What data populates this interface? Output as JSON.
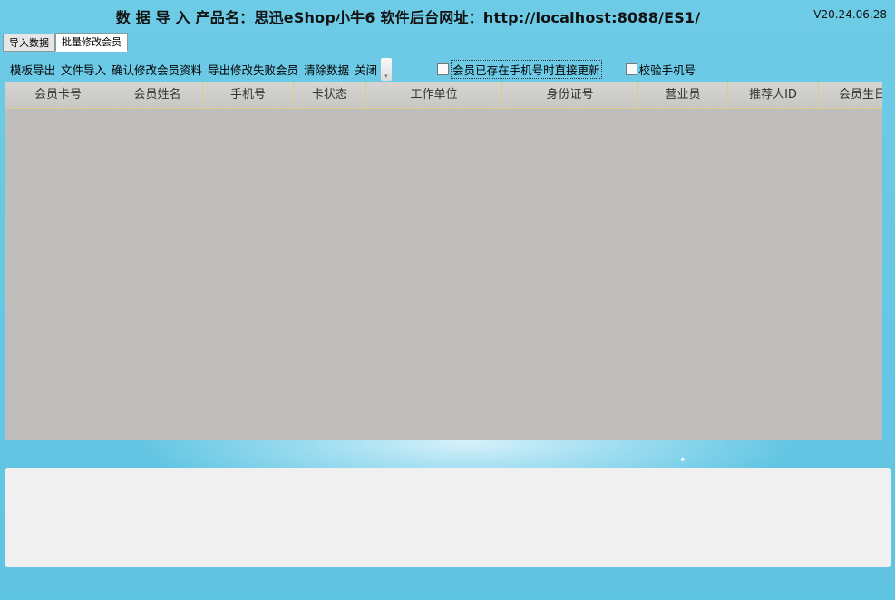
{
  "header": {
    "title": "数 据 导 入  产品名：思迅eShop小牛6  软件后台网址：http://localhost:8088/ES1/",
    "version": "V20.24.06.28"
  },
  "tabs": [
    {
      "label": "导入数据"
    },
    {
      "label": "批量修改会员"
    }
  ],
  "toolbar": {
    "template_export": "模板导出",
    "file_import": "文件导入",
    "confirm_modify": "确认修改会员资料",
    "export_failed": "导出修改失败会员",
    "clear_data": "清除数据",
    "close": "关闭",
    "update_if_exists_label": "会员已存在手机号时直接更新",
    "verify_phone_label": "校验手机号"
  },
  "table": {
    "columns": [
      "会员卡号",
      "会员姓名",
      "手机号",
      "卡状态",
      "工作单位",
      "身份证号",
      "营业员",
      "推荐人ID",
      "会员生日"
    ],
    "rows": []
  },
  "colors": {
    "background": "#5fc4e2",
    "grid_background": "#bfbebc",
    "header_border": "#d9cf8a",
    "log_panel": "#f0f0f0"
  }
}
